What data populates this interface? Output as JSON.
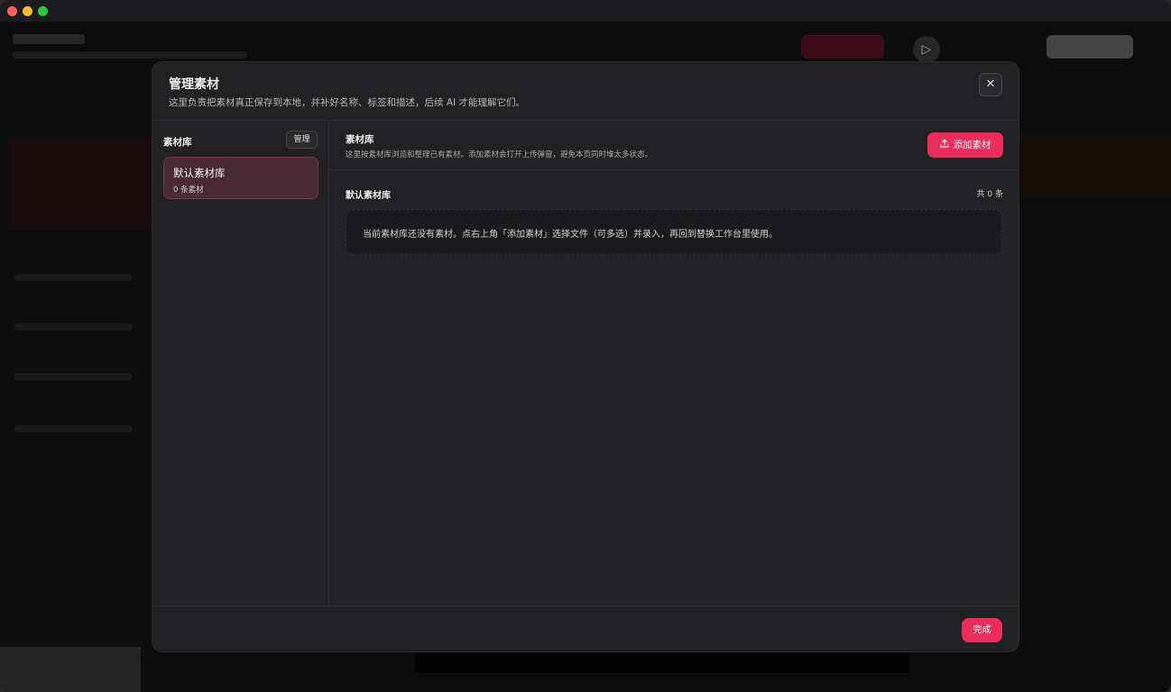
{
  "modal": {
    "title": "管理素材",
    "subtitle": "这里负责把素材真正保存到本地，并补好名称、标签和描述，后续 AI 才能理解它们。",
    "close_icon": "✕"
  },
  "sidebar": {
    "title": "素材库",
    "manage_label": "管理",
    "libraries": [
      {
        "name": "默认素材库",
        "count_label": "0 条素材"
      }
    ]
  },
  "main": {
    "title": "素材库",
    "subtitle": "这里按素材库浏览和整理已有素材。添加素材会打开上传弹窗，避免本页同时堆太多状态。",
    "add_label": "添加素材",
    "add_icon": "upload-icon",
    "section_title": "默认素材库",
    "section_count": "共 0 条",
    "empty_text": "当前素材库还没有素材。点右上角「添加素材」选择文件（可多选）并录入，再回到替换工作台里使用。"
  },
  "footer": {
    "done_label": "完成"
  },
  "colors": {
    "accent": "#ec2c5c",
    "selected_card": "#4a2a34",
    "modal_bg": "#222224"
  }
}
